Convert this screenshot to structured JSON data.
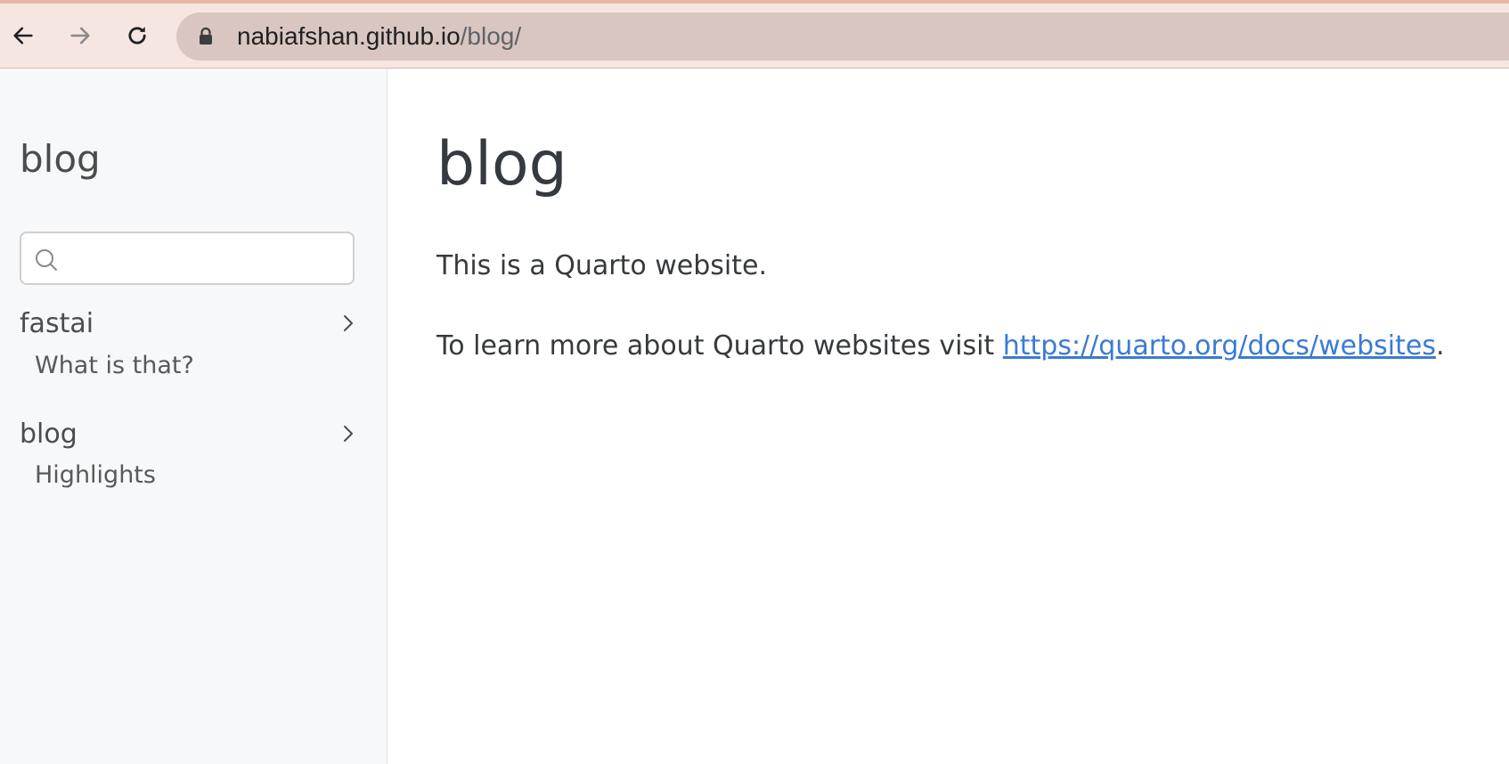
{
  "browser": {
    "url_host": "nabiafshan.github.io",
    "url_path": "/blog/",
    "icons": {
      "back": "back-arrow-icon",
      "forward": "forward-arrow-icon",
      "reload": "reload-icon",
      "lock": "lock-icon"
    }
  },
  "sidebar": {
    "title": "blog",
    "search": {
      "placeholder": "",
      "value": ""
    },
    "sections": [
      {
        "label": "fastai",
        "items": [
          "What is that?"
        ]
      },
      {
        "label": "blog",
        "items": [
          "Highlights"
        ]
      }
    ]
  },
  "main": {
    "title": "blog",
    "paragraph1": "This is a Quarto website.",
    "paragraph2_prefix": "To learn more about Quarto websites visit ",
    "link_text": "https://quarto.org/docs/websites",
    "paragraph2_suffix": "."
  },
  "colors": {
    "chrome_background": "#f6e6e1",
    "address_bar": "#d9c6c1",
    "sidebar_background": "#f7f8fa",
    "link": "#3a7bd5"
  }
}
